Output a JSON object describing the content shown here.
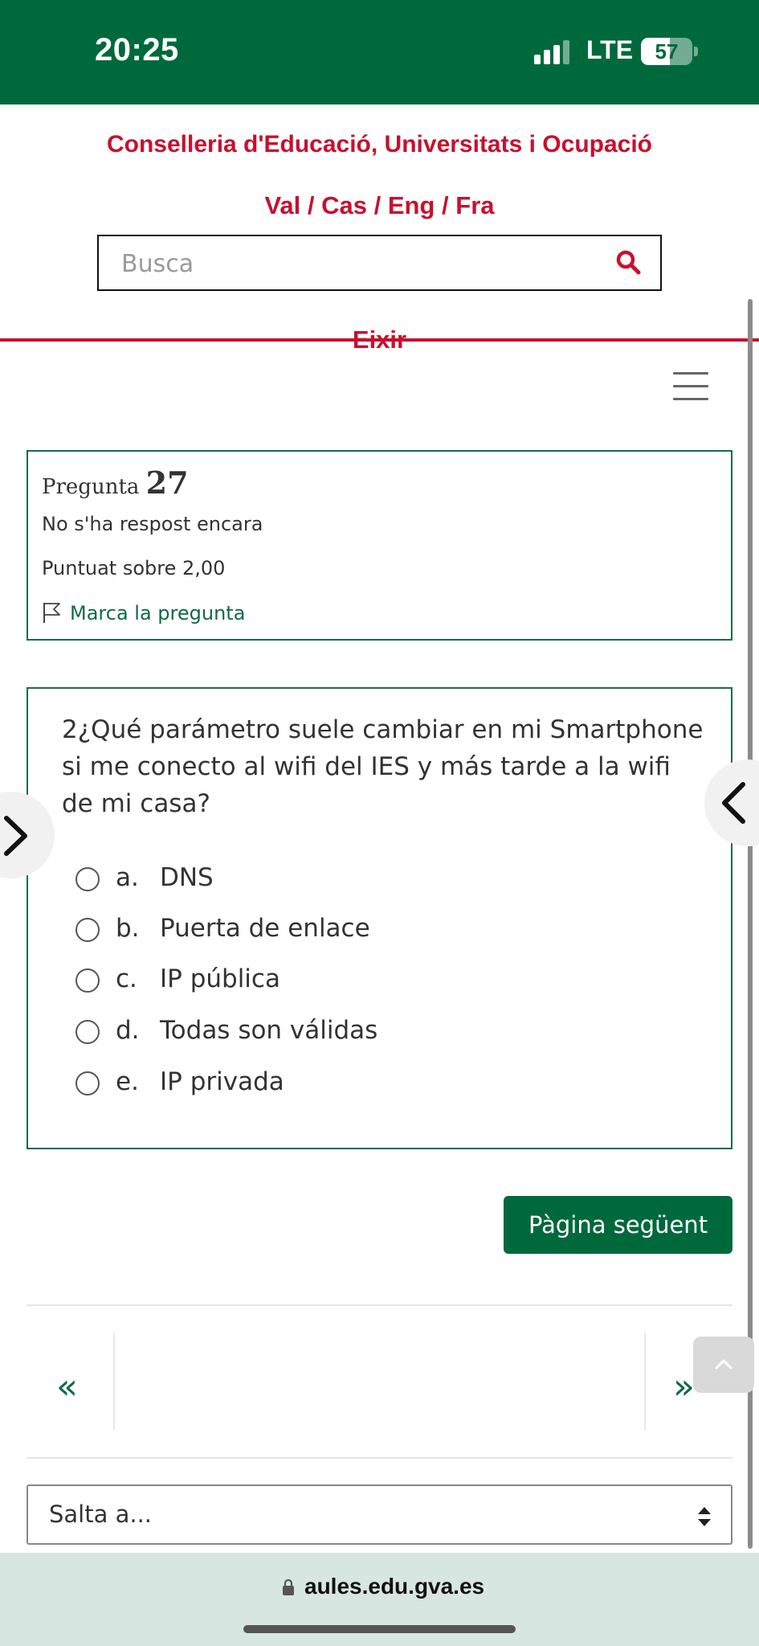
{
  "status_bar": {
    "time": "20:25",
    "network": "LTE",
    "battery": "57",
    "battery_level": 0.57
  },
  "header": {
    "org_name": "Conselleria d'Educació, Universitats i Ocupació",
    "languages": [
      "Val",
      "Cas",
      "Eng",
      "Fra"
    ],
    "lang_separator": " / ",
    "search_placeholder": "Busca",
    "logout_label": "Eixir"
  },
  "question_info": {
    "label": "Pregunta",
    "number": "27",
    "status": "No s'ha respost encara",
    "score": "Puntuat sobre 2,00",
    "flag_label": "Marca la pregunta"
  },
  "question": {
    "text": "2¿Qué parámetro suele cambiar en mi Smartphone si me conecto al wifi del IES y más tarde a la wifi de mi casa?",
    "options": [
      {
        "letter": "a.",
        "text": "DNS"
      },
      {
        "letter": "b.",
        "text": "Puerta de enlace"
      },
      {
        "letter": "c.",
        "text": "IP pública"
      },
      {
        "letter": "d.",
        "text": "Todas son válidas"
      },
      {
        "letter": "e.",
        "text": "IP privada"
      }
    ]
  },
  "navigation": {
    "next_page_label": "Pàgina següent",
    "prev_arrow": "«",
    "next_arrow": "»",
    "jump_label": "Salta a..."
  },
  "browser": {
    "url": "aules.edu.gva.es"
  },
  "colors": {
    "brand_green": "#00693c",
    "accent_red": "#c8102e",
    "url_bar": "#d8e6e1"
  }
}
